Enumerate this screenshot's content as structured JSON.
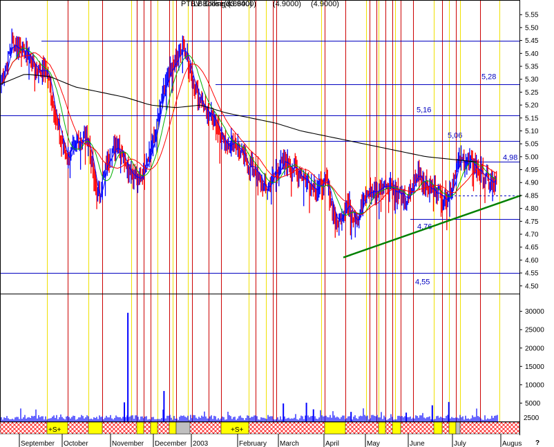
{
  "chart_data": {
    "type": "line",
    "title_overprint": [
      "PTBV",
      "LBBollinger",
      "Close(3.8600)",
      "(3.9400)",
      "(4.9000)",
      "(4.9000)"
    ],
    "price_axis": {
      "ticks": [
        "5.55",
        "5.50",
        "5.45",
        "5.40",
        "5.35",
        "5.30",
        "5.25",
        "5.20",
        "5.15",
        "5.10",
        "5.05",
        "5.00",
        "4.95",
        "4.90",
        "4.85",
        "4.80",
        "4.75",
        "4.70",
        "4.65",
        "4.60",
        "4.55",
        "4.50"
      ],
      "ylim": [
        4.47,
        5.58
      ]
    },
    "volume_axis": {
      "ticks": [
        "30000",
        "25000",
        "20000",
        "15000",
        "10000",
        "5000"
      ],
      "ylim": [
        0,
        32000
      ]
    },
    "sub_axis_label": "2500",
    "corner_label": "?",
    "x_axis_labels": [
      "September",
      "October",
      "November",
      "December",
      "2003",
      "February",
      "March",
      "April",
      "May",
      "June",
      "July",
      "Augus"
    ],
    "horizontal_levels": [
      {
        "value": 5.45,
        "label": ""
      },
      {
        "value": 5.28,
        "label": "5,28"
      },
      {
        "value": 5.16,
        "label": "5,16"
      },
      {
        "value": 5.06,
        "label": "5,06"
      },
      {
        "value": 4.98,
        "label": "4,98"
      },
      {
        "value": 4.76,
        "label": "4,76"
      },
      {
        "value": 4.55,
        "label": "4,55"
      }
    ],
    "dashed_level": 4.85,
    "trendline": {
      "from": {
        "day": 0.664,
        "value": 4.61
      },
      "to": {
        "day": 1.0,
        "value": 4.85
      }
    },
    "price_anchors": {
      "day": [
        0,
        0.02,
        0.05,
        0.07,
        0.09,
        0.11,
        0.13,
        0.15,
        0.17,
        0.19,
        0.21,
        0.23,
        0.25,
        0.27,
        0.29,
        0.3,
        0.32,
        0.34,
        0.36,
        0.38,
        0.4,
        0.42,
        0.44,
        0.46,
        0.48,
        0.5,
        0.52,
        0.54,
        0.56,
        0.58,
        0.6,
        0.62,
        0.64,
        0.66,
        0.68,
        0.7,
        0.72,
        0.74,
        0.76,
        0.78,
        0.8,
        0.82,
        0.84,
        0.86,
        0.88,
        0.9,
        0.92,
        0.94,
        0.96
      ],
      "close": [
        5.28,
        5.44,
        5.4,
        5.34,
        5.33,
        5.12,
        4.99,
        5.06,
        5.07,
        4.83,
        5.0,
        5.05,
        4.96,
        4.9,
        5.01,
        5.06,
        5.26,
        5.36,
        5.42,
        5.28,
        5.18,
        5.15,
        5.05,
        5.06,
        4.98,
        4.95,
        4.87,
        4.94,
        4.98,
        4.95,
        4.91,
        4.88,
        4.9,
        4.74,
        4.82,
        4.76,
        4.86,
        4.87,
        4.9,
        4.86,
        4.83,
        4.94,
        4.88,
        4.86,
        4.84,
        4.98,
        4.98,
        4.95,
        4.9
      ]
    },
    "ma200_anchors": {
      "day": [
        0,
        0.05,
        0.1,
        0.15,
        0.2,
        0.25,
        0.3,
        0.35,
        0.4,
        0.45,
        0.5,
        0.55,
        0.6,
        0.65,
        0.7,
        0.75,
        0.8,
        0.85,
        0.9,
        0.95
      ],
      "value": [
        5.28,
        5.32,
        5.31,
        5.27,
        5.25,
        5.23,
        5.2,
        5.19,
        5.2,
        5.17,
        5.15,
        5.13,
        5.1,
        5.08,
        5.06,
        5.04,
        5.02,
        5.0,
        4.99,
        4.98
      ]
    },
    "volume_spikes": [
      {
        "day": 0.255,
        "value": 29600
      },
      {
        "day": 0.248,
        "value": 5200
      },
      {
        "day": 0.327,
        "value": 8300
      },
      {
        "day": 0.565,
        "value": 4900
      },
      {
        "day": 0.611,
        "value": 5100
      },
      {
        "day": 0.625,
        "value": 3300
      },
      {
        "day": 0.7,
        "value": 2600
      },
      {
        "day": 0.81,
        "value": 2400
      },
      {
        "day": 0.862,
        "value": 4400
      },
      {
        "day": 0.895,
        "value": 5300
      }
    ],
    "signal_bar": [
      {
        "kind": "S",
        "label": "+S+"
      },
      {
        "kind": "S",
        "label": "+S+"
      }
    ],
    "colors": {
      "price_up": "#0000ff",
      "price_down": "#ff0000",
      "ma_short": "#0000ff",
      "ma_mid": "#00b000",
      "ma_long": "#ff0000",
      "ma_200": "#000000",
      "level_line": "#0000c0",
      "trendline": "#008000",
      "vline_red": "#cc0000",
      "vline_yellow": "#f0e000",
      "volume": "#0000ff",
      "signal_yellow": "#ffff00",
      "signal_gray": "#c0c0c0",
      "signal_hatch": "#ff0000"
    }
  }
}
